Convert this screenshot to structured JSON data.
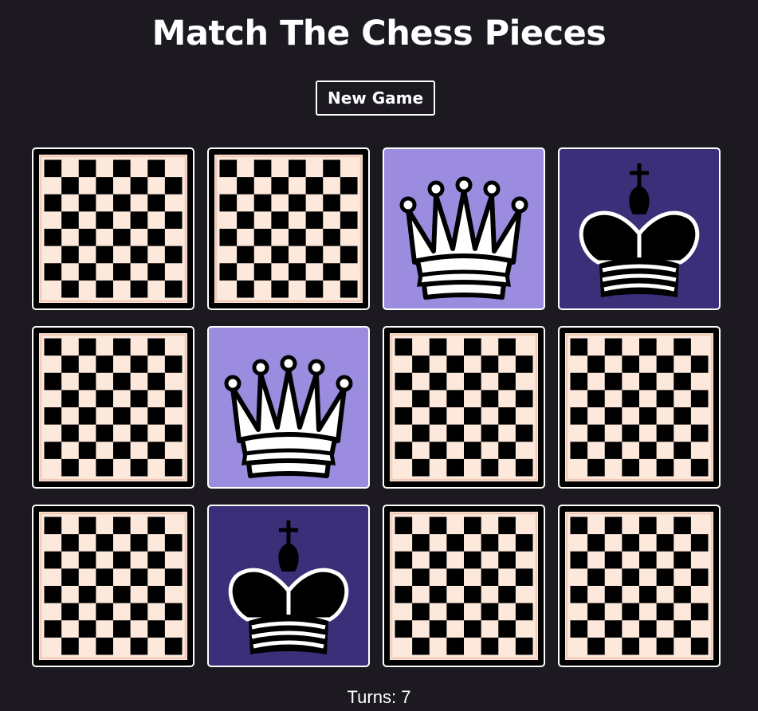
{
  "title": "Match The Chess Pieces",
  "new_game_label": "New Game",
  "turns": {
    "label": "Turns:",
    "value": 7
  },
  "colors": {
    "background": "#1c1921",
    "white_piece_card": "#9b8ce0",
    "black_piece_card": "#3b2f7a",
    "board_light": "#fde8dc",
    "board_dark": "#000000"
  },
  "cards": [
    {
      "row": 1,
      "col": 1,
      "state": "face-down",
      "icon": "chessboard-icon"
    },
    {
      "row": 1,
      "col": 2,
      "state": "face-down",
      "icon": "chessboard-icon"
    },
    {
      "row": 1,
      "col": 3,
      "state": "face-up",
      "piece": "white-queen",
      "icon": "white-queen-icon"
    },
    {
      "row": 1,
      "col": 4,
      "state": "face-up",
      "piece": "black-king",
      "icon": "black-king-icon"
    },
    {
      "row": 2,
      "col": 1,
      "state": "face-down",
      "icon": "chessboard-icon"
    },
    {
      "row": 2,
      "col": 2,
      "state": "face-up",
      "piece": "white-queen",
      "icon": "white-queen-icon"
    },
    {
      "row": 2,
      "col": 3,
      "state": "face-down",
      "icon": "chessboard-icon"
    },
    {
      "row": 2,
      "col": 4,
      "state": "face-down",
      "icon": "chessboard-icon"
    },
    {
      "row": 3,
      "col": 1,
      "state": "face-down",
      "icon": "chessboard-icon"
    },
    {
      "row": 3,
      "col": 2,
      "state": "face-up",
      "piece": "black-king",
      "icon": "black-king-icon"
    },
    {
      "row": 3,
      "col": 3,
      "state": "face-down",
      "icon": "chessboard-icon"
    },
    {
      "row": 3,
      "col": 4,
      "state": "face-down",
      "icon": "chessboard-icon"
    }
  ]
}
